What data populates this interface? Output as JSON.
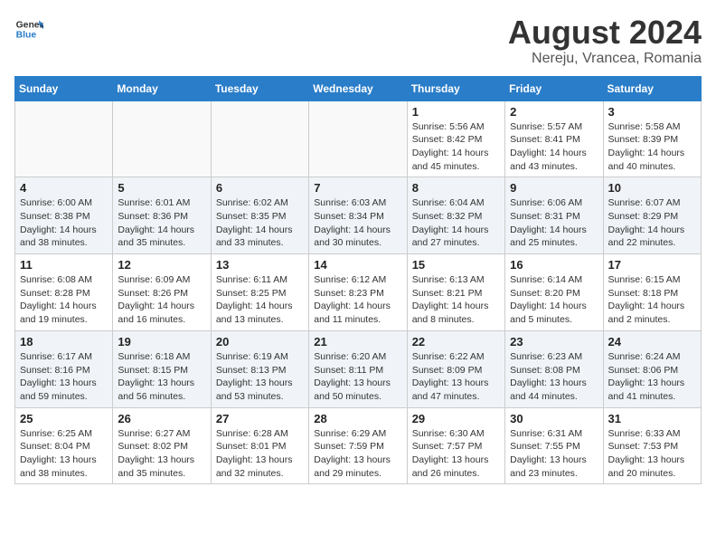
{
  "header": {
    "logo_line1": "General",
    "logo_line2": "Blue",
    "title": "August 2024",
    "subtitle": "Nereju, Vrancea, Romania"
  },
  "days_of_week": [
    "Sunday",
    "Monday",
    "Tuesday",
    "Wednesday",
    "Thursday",
    "Friday",
    "Saturday"
  ],
  "weeks": [
    [
      {
        "day": "",
        "info": ""
      },
      {
        "day": "",
        "info": ""
      },
      {
        "day": "",
        "info": ""
      },
      {
        "day": "",
        "info": ""
      },
      {
        "day": "1",
        "info": "Sunrise: 5:56 AM\nSunset: 8:42 PM\nDaylight: 14 hours\nand 45 minutes."
      },
      {
        "day": "2",
        "info": "Sunrise: 5:57 AM\nSunset: 8:41 PM\nDaylight: 14 hours\nand 43 minutes."
      },
      {
        "day": "3",
        "info": "Sunrise: 5:58 AM\nSunset: 8:39 PM\nDaylight: 14 hours\nand 40 minutes."
      }
    ],
    [
      {
        "day": "4",
        "info": "Sunrise: 6:00 AM\nSunset: 8:38 PM\nDaylight: 14 hours\nand 38 minutes."
      },
      {
        "day": "5",
        "info": "Sunrise: 6:01 AM\nSunset: 8:36 PM\nDaylight: 14 hours\nand 35 minutes."
      },
      {
        "day": "6",
        "info": "Sunrise: 6:02 AM\nSunset: 8:35 PM\nDaylight: 14 hours\nand 33 minutes."
      },
      {
        "day": "7",
        "info": "Sunrise: 6:03 AM\nSunset: 8:34 PM\nDaylight: 14 hours\nand 30 minutes."
      },
      {
        "day": "8",
        "info": "Sunrise: 6:04 AM\nSunset: 8:32 PM\nDaylight: 14 hours\nand 27 minutes."
      },
      {
        "day": "9",
        "info": "Sunrise: 6:06 AM\nSunset: 8:31 PM\nDaylight: 14 hours\nand 25 minutes."
      },
      {
        "day": "10",
        "info": "Sunrise: 6:07 AM\nSunset: 8:29 PM\nDaylight: 14 hours\nand 22 minutes."
      }
    ],
    [
      {
        "day": "11",
        "info": "Sunrise: 6:08 AM\nSunset: 8:28 PM\nDaylight: 14 hours\nand 19 minutes."
      },
      {
        "day": "12",
        "info": "Sunrise: 6:09 AM\nSunset: 8:26 PM\nDaylight: 14 hours\nand 16 minutes."
      },
      {
        "day": "13",
        "info": "Sunrise: 6:11 AM\nSunset: 8:25 PM\nDaylight: 14 hours\nand 13 minutes."
      },
      {
        "day": "14",
        "info": "Sunrise: 6:12 AM\nSunset: 8:23 PM\nDaylight: 14 hours\nand 11 minutes."
      },
      {
        "day": "15",
        "info": "Sunrise: 6:13 AM\nSunset: 8:21 PM\nDaylight: 14 hours\nand 8 minutes."
      },
      {
        "day": "16",
        "info": "Sunrise: 6:14 AM\nSunset: 8:20 PM\nDaylight: 14 hours\nand 5 minutes."
      },
      {
        "day": "17",
        "info": "Sunrise: 6:15 AM\nSunset: 8:18 PM\nDaylight: 14 hours\nand 2 minutes."
      }
    ],
    [
      {
        "day": "18",
        "info": "Sunrise: 6:17 AM\nSunset: 8:16 PM\nDaylight: 13 hours\nand 59 minutes."
      },
      {
        "day": "19",
        "info": "Sunrise: 6:18 AM\nSunset: 8:15 PM\nDaylight: 13 hours\nand 56 minutes."
      },
      {
        "day": "20",
        "info": "Sunrise: 6:19 AM\nSunset: 8:13 PM\nDaylight: 13 hours\nand 53 minutes."
      },
      {
        "day": "21",
        "info": "Sunrise: 6:20 AM\nSunset: 8:11 PM\nDaylight: 13 hours\nand 50 minutes."
      },
      {
        "day": "22",
        "info": "Sunrise: 6:22 AM\nSunset: 8:09 PM\nDaylight: 13 hours\nand 47 minutes."
      },
      {
        "day": "23",
        "info": "Sunrise: 6:23 AM\nSunset: 8:08 PM\nDaylight: 13 hours\nand 44 minutes."
      },
      {
        "day": "24",
        "info": "Sunrise: 6:24 AM\nSunset: 8:06 PM\nDaylight: 13 hours\nand 41 minutes."
      }
    ],
    [
      {
        "day": "25",
        "info": "Sunrise: 6:25 AM\nSunset: 8:04 PM\nDaylight: 13 hours\nand 38 minutes."
      },
      {
        "day": "26",
        "info": "Sunrise: 6:27 AM\nSunset: 8:02 PM\nDaylight: 13 hours\nand 35 minutes."
      },
      {
        "day": "27",
        "info": "Sunrise: 6:28 AM\nSunset: 8:01 PM\nDaylight: 13 hours\nand 32 minutes."
      },
      {
        "day": "28",
        "info": "Sunrise: 6:29 AM\nSunset: 7:59 PM\nDaylight: 13 hours\nand 29 minutes."
      },
      {
        "day": "29",
        "info": "Sunrise: 6:30 AM\nSunset: 7:57 PM\nDaylight: 13 hours\nand 26 minutes."
      },
      {
        "day": "30",
        "info": "Sunrise: 6:31 AM\nSunset: 7:55 PM\nDaylight: 13 hours\nand 23 minutes."
      },
      {
        "day": "31",
        "info": "Sunrise: 6:33 AM\nSunset: 7:53 PM\nDaylight: 13 hours\nand 20 minutes."
      }
    ]
  ]
}
